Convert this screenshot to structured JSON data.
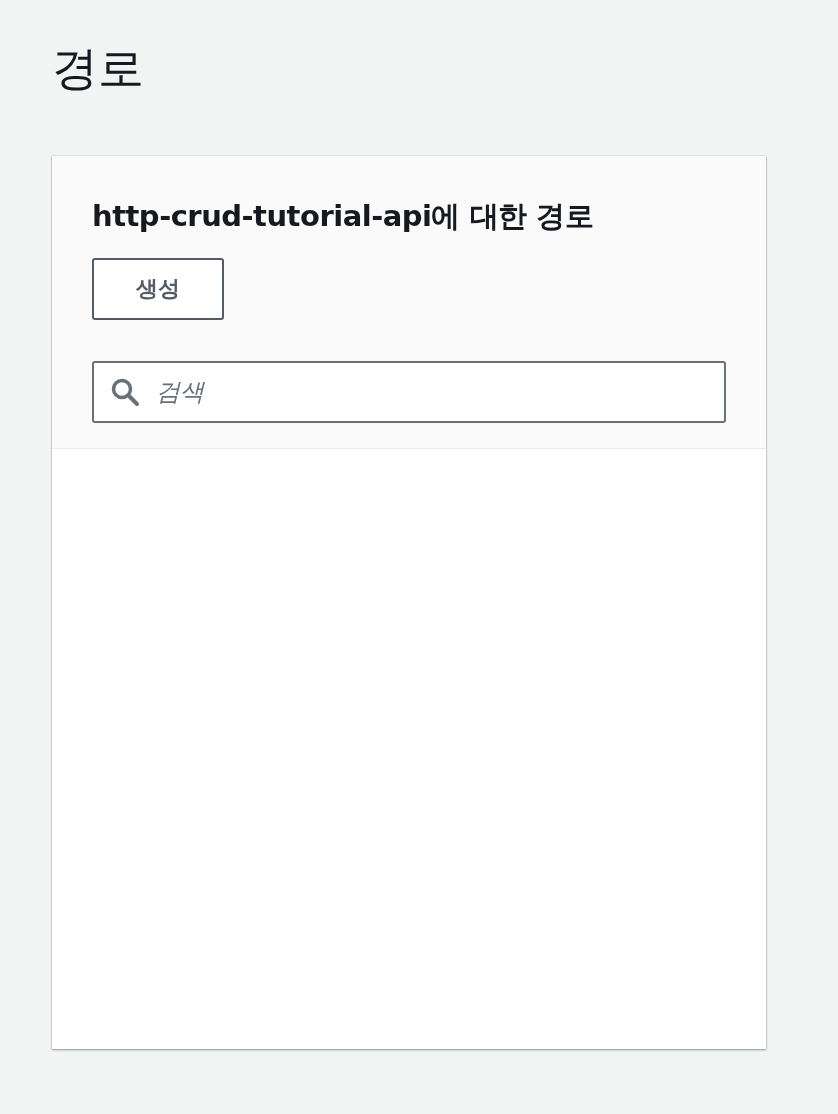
{
  "page": {
    "title": "경로"
  },
  "panel": {
    "title": "http-crud-tutorial-api에 대한 경로",
    "create_button": "생성",
    "search": {
      "placeholder": "검색"
    }
  }
}
